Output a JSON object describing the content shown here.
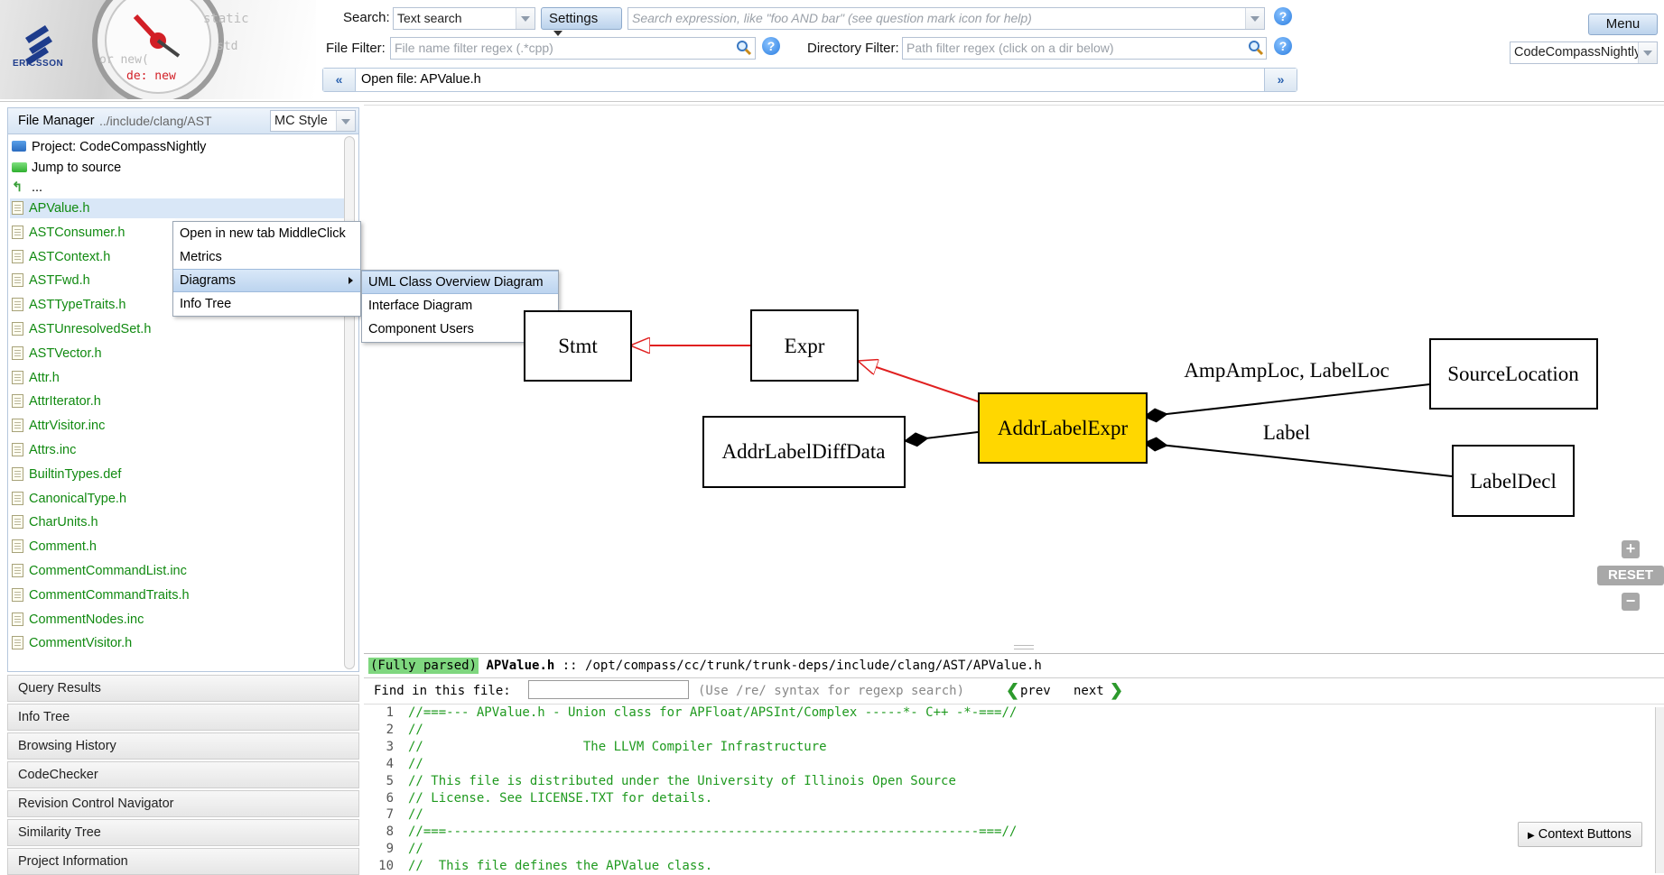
{
  "header": {
    "search_label": "Search:",
    "search_type": "Text search",
    "settings_label": "Settings",
    "expression_placeholder": "Search expression, like \"foo AND bar\" (see question mark icon for help)",
    "file_filter_label": "File Filter:",
    "file_filter_placeholder": "File name filter regex (.*cpp)",
    "dir_filter_label": "Directory Filter:",
    "dir_filter_placeholder": "Path filter regex (click on a dir below)",
    "open_file": "Open file: APValue.h",
    "menu_label": "Menu",
    "project": "CodeCompassNightly",
    "help_glyph": "?",
    "logo_text": "ERICSSON"
  },
  "file_manager": {
    "title": "File Manager",
    "path": "../include/clang/AST",
    "style": "MC Style",
    "special": [
      {
        "label": "Project: CodeCompassNightly",
        "icon": "folder-icon"
      },
      {
        "label": "Jump to source",
        "icon": "green-bar-icon"
      },
      {
        "label": "...",
        "icon": "up-arrow-icon"
      }
    ],
    "files": [
      "APValue.h",
      "ASTConsumer.h",
      "ASTContext.h",
      "ASTFwd.h",
      "ASTTypeTraits.h",
      "ASTUnresolvedSet.h",
      "ASTVector.h",
      "Attr.h",
      "AttrIterator.h",
      "AttrVisitor.inc",
      "Attrs.inc",
      "BuiltinTypes.def",
      "CanonicalType.h",
      "CharUnits.h",
      "Comment.h",
      "CommentCommandList.inc",
      "CommentCommandTraits.h",
      "CommentNodes.inc",
      "CommentVisitor.h"
    ]
  },
  "context_menu": {
    "items": [
      "Open in new tab MiddleClick",
      "Metrics",
      "Diagrams",
      "Info Tree"
    ],
    "submenu": [
      "UML Class Overview Diagram",
      "Interface Diagram",
      "Component Users"
    ]
  },
  "accordion": [
    "Query Results",
    "Info Tree",
    "Browsing History",
    "CodeChecker",
    "Revision Control Navigator",
    "Similarity Tree",
    "Project Information"
  ],
  "diagram": {
    "nodes": {
      "stmt": "Stmt",
      "expr": "Expr",
      "addrlabelexpr": "AddrLabelExpr",
      "addrlabeldiffdata": "AddrLabelDiffData",
      "sourcelocation": "SourceLocation",
      "labeldecl": "LabelDecl"
    },
    "edge_labels": {
      "loc": "AmpAmpLoc, LabelLoc",
      "label": "Label"
    },
    "highlight_color": "#ffd700",
    "inherit_color": "#e02020",
    "zoom": {
      "reset": "RESET"
    }
  },
  "code": {
    "status": "(Fully parsed)",
    "filename": "APValue.h",
    "path_sep": "::",
    "path": "/opt/compass/cc/trunk/trunk-deps/include/clang/AST/APValue.h",
    "find_label": "Find in this file:",
    "find_hint": "(Use /re/ syntax for regexp search)",
    "prev": "prev",
    "next": "next",
    "context_buttons": "Context Buttons",
    "lines": [
      {
        "n": "1",
        "t": "//===--- APValue.h - Union class for APFloat/APSInt/Complex -----*- C++ -*-===//"
      },
      {
        "n": "2",
        "t": "//"
      },
      {
        "n": "3",
        "t": "//                     The LLVM Compiler Infrastructure"
      },
      {
        "n": "4",
        "t": "//"
      },
      {
        "n": "5",
        "t": "// This file is distributed under the University of Illinois Open Source"
      },
      {
        "n": "6",
        "t": "// License. See LICENSE.TXT for details."
      },
      {
        "n": "7",
        "t": "//"
      },
      {
        "n": "8",
        "t": "//===----------------------------------------------------------------------===//"
      },
      {
        "n": "9",
        "t": "//"
      },
      {
        "n": "10",
        "t": "//  This file defines the APValue class."
      }
    ]
  }
}
